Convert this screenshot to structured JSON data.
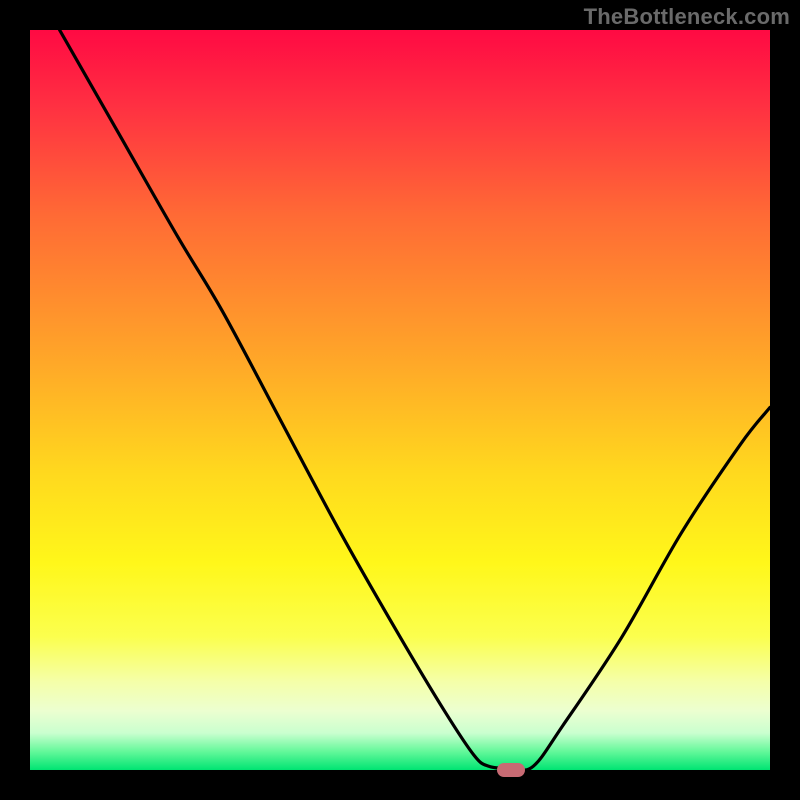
{
  "watermark": "TheBottleneck.com",
  "chart_data": {
    "type": "line",
    "title": "",
    "xlabel": "",
    "ylabel": "",
    "xlim": [
      0,
      100
    ],
    "ylim": [
      0,
      100
    ],
    "grid": false,
    "series": [
      {
        "name": "curve",
        "points": [
          {
            "x": 4,
            "y": 100
          },
          {
            "x": 12,
            "y": 86
          },
          {
            "x": 20,
            "y": 72
          },
          {
            "x": 26,
            "y": 62
          },
          {
            "x": 34,
            "y": 47
          },
          {
            "x": 42,
            "y": 32
          },
          {
            "x": 50,
            "y": 18
          },
          {
            "x": 56,
            "y": 8
          },
          {
            "x": 60,
            "y": 2
          },
          {
            "x": 62,
            "y": 0.5
          },
          {
            "x": 65,
            "y": 0.2
          },
          {
            "x": 68,
            "y": 0.5
          },
          {
            "x": 72,
            "y": 6
          },
          {
            "x": 80,
            "y": 18
          },
          {
            "x": 88,
            "y": 32
          },
          {
            "x": 96,
            "y": 44
          },
          {
            "x": 100,
            "y": 49
          }
        ]
      }
    ],
    "background_gradient": {
      "top_color": "#ff0a43",
      "bottom_color": "#00e472"
    },
    "marker": {
      "x": 65,
      "y": 0,
      "color": "#c76a73"
    }
  }
}
